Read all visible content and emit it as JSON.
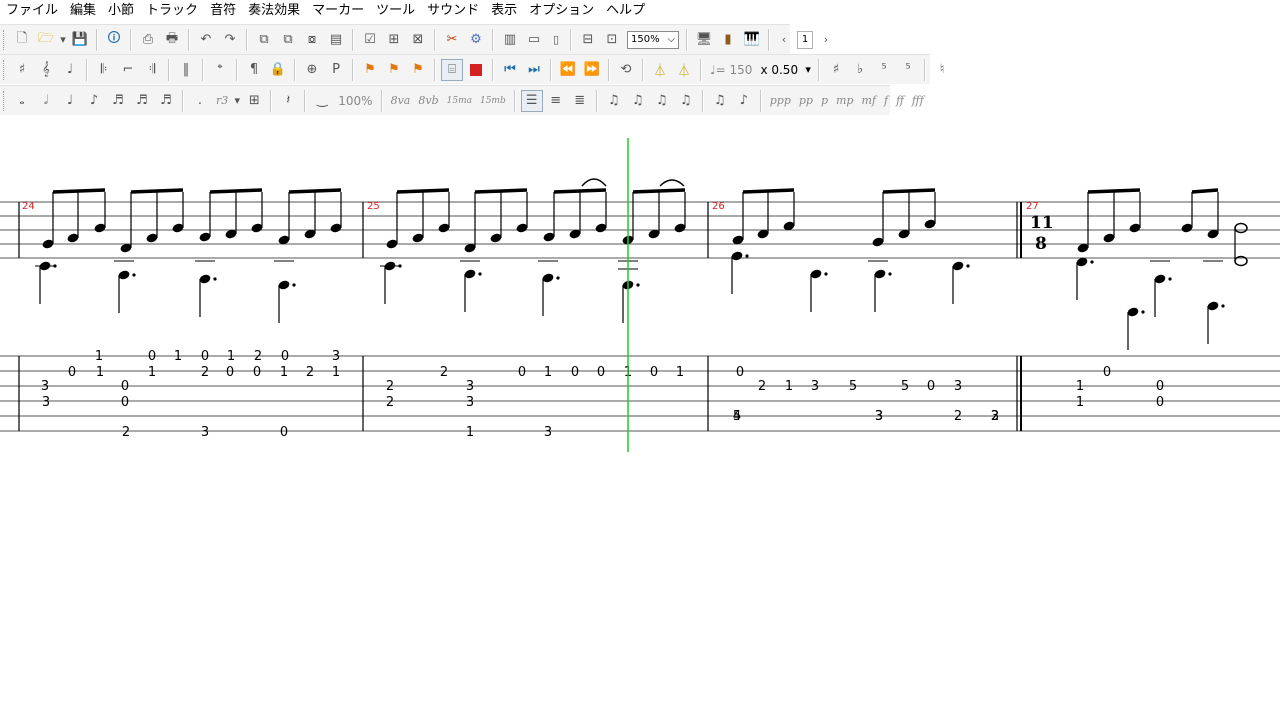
{
  "menu": [
    "ファイル",
    "編集",
    "小節",
    "トラック",
    "音符",
    "奏法効果",
    "マーカー",
    "ツール",
    "サウンド",
    "表示",
    "オプション",
    "ヘルプ"
  ],
  "toolbar": {
    "zoom": "150%",
    "page": "1",
    "tempo": "♩= 150",
    "speed": "x 0.50",
    "percent": "100%",
    "triplet": "r3",
    "octave_labels": [
      "8va",
      "8vb",
      "15ma",
      "15mb"
    ],
    "dynamics": [
      "ppp",
      "pp",
      "p",
      "mp",
      "mf",
      "f",
      "ff",
      "fff"
    ]
  },
  "colors": {
    "playhead": "#22cc22",
    "measure_number": "#e0201c",
    "stop": "#d42020",
    "transport": "#1a6aa8"
  },
  "score": {
    "measures": [
      {
        "number": "24"
      },
      {
        "number": "25"
      },
      {
        "number": "26"
      },
      {
        "number": "27",
        "time_signature": [
          "11",
          "8"
        ]
      }
    ],
    "tab_numbers": [
      [
        "0",
        "1",
        "0",
        "1",
        "2",
        "0",
        "1",
        "0",
        "0",
        "1"
      ],
      [
        "3",
        "0",
        "2",
        "3",
        "1",
        "0"
      ],
      [
        "1",
        "2",
        "0",
        "1",
        "2",
        "0",
        "1",
        "0",
        "1",
        "0"
      ],
      [
        "3",
        "0",
        "2",
        "3",
        "1",
        "0"
      ],
      [
        "2",
        "1",
        "5",
        "5",
        "0",
        "3",
        "3"
      ],
      [
        "4",
        "5",
        "3",
        "3",
        "2",
        "2",
        "3"
      ],
      [
        "1",
        "0",
        "1",
        "0",
        "1",
        "2",
        "0",
        "3"
      ],
      [
        "2",
        "3",
        "0",
        "1",
        "3"
      ]
    ]
  }
}
